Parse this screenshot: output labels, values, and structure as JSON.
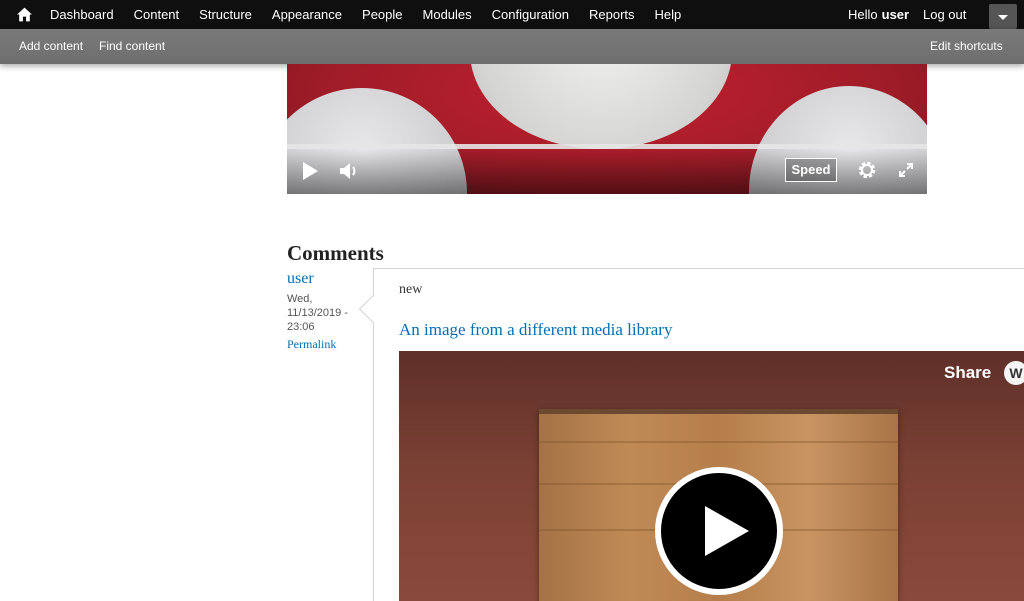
{
  "toolbar": {
    "home_icon": "home-icon",
    "menu": [
      "Dashboard",
      "Content",
      "Structure",
      "Appearance",
      "People",
      "Modules",
      "Configuration",
      "Reports",
      "Help"
    ],
    "hello": "Hello",
    "username": "user",
    "logout": "Log out",
    "dropdown_icon": "chevron-down-icon"
  },
  "shortcuts": {
    "add_content": "Add content",
    "find_content": "Find content",
    "edit_shortcuts": "Edit shortcuts"
  },
  "video_player": {
    "speed_label": "Speed",
    "icons": [
      "play-icon",
      "volume-icon",
      "gear-icon",
      "fullscreen-icon"
    ]
  },
  "comments": {
    "heading": "Comments",
    "items": [
      {
        "author": "user",
        "date": "Wed, 11/13/2019 - 23:06",
        "permalink": "Permalink",
        "new_marker": "new",
        "title": "An image from a different media library",
        "embed": {
          "share_label": "Share",
          "logo_text": "W"
        }
      }
    ]
  },
  "colors": {
    "toolbar_bg": "#0f0f0f",
    "shortcuts_bg": "#737373",
    "link": "#0071b3"
  }
}
